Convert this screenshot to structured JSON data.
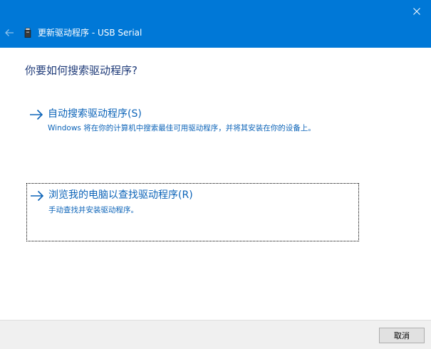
{
  "window": {
    "title": "更新驱动程序 - USB Serial",
    "icons": {
      "close": "close-icon",
      "back": "back-arrow-icon",
      "device": "usb-device-icon"
    }
  },
  "main": {
    "question": "你要如何搜索驱动程序?",
    "options": [
      {
        "title": "自动搜索驱动程序(S)",
        "description": "Windows 将在你的计算机中搜索最佳可用驱动程序，并将其安装在你的设备上。",
        "icon": "arrow-right-icon"
      },
      {
        "title": "浏览我的电脑以查找驱动程序(R)",
        "description": "手动查找并安装驱动程序。",
        "icon": "arrow-right-icon"
      }
    ]
  },
  "footer": {
    "cancel_label": "取消"
  },
  "colors": {
    "titlebar": "#0078d7",
    "link": "#0b63b8",
    "heading": "#1e3a78",
    "footer": "#f0f0f0"
  }
}
